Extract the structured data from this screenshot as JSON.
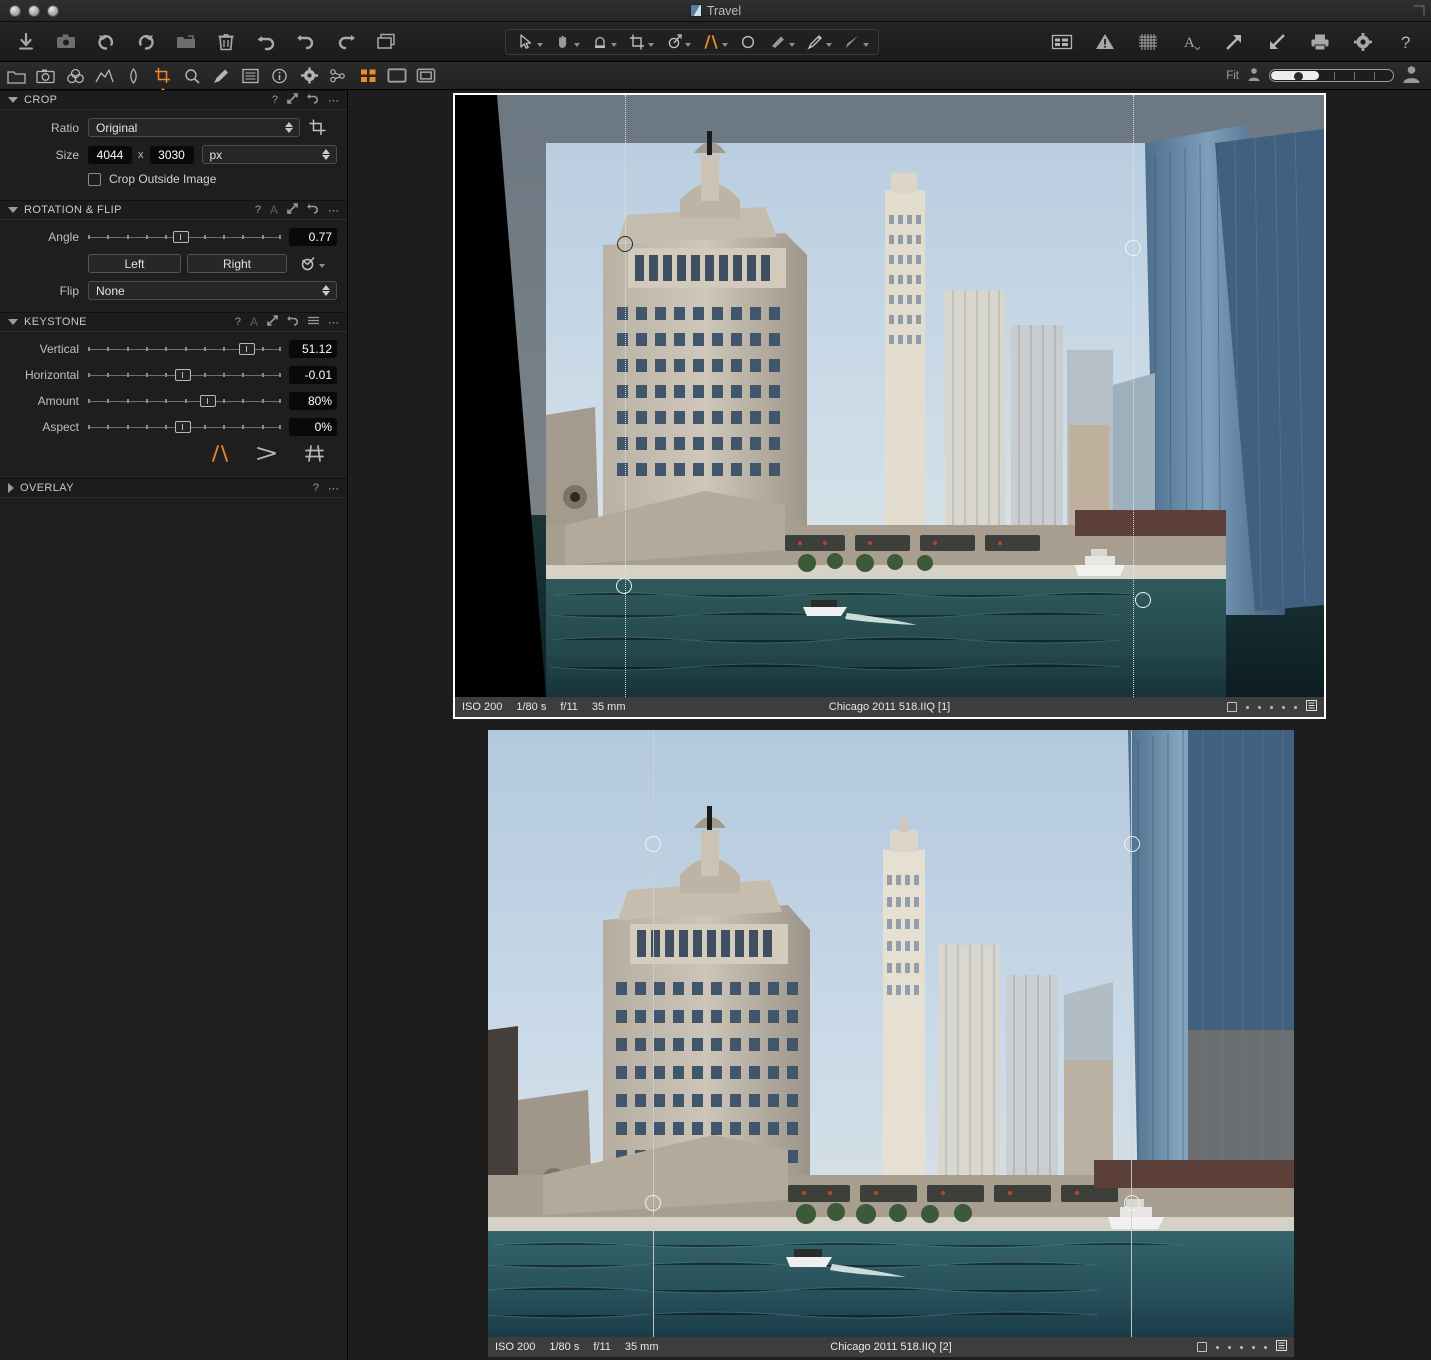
{
  "window": {
    "title": "Travel"
  },
  "toolbar": {
    "left_tools": [
      {
        "name": "import-images-icon",
        "label": "Import Images"
      },
      {
        "name": "capture-icon",
        "label": "Capture"
      },
      {
        "name": "rotate-left-icon",
        "label": "Rotate Left"
      },
      {
        "name": "rotate-right-icon",
        "label": "Rotate Right"
      },
      {
        "name": "move-to-folder-icon",
        "label": "Move to Folder"
      },
      {
        "name": "delete-icon",
        "label": "Delete"
      },
      {
        "name": "reset-icon",
        "label": "Reset Adjustments"
      },
      {
        "name": "undo-icon",
        "label": "Undo"
      },
      {
        "name": "redo-icon",
        "label": "Redo"
      },
      {
        "name": "copy-apply-icon",
        "label": "Copy and Apply Adjustments"
      }
    ],
    "center_tools": [
      {
        "name": "pointer-tool-icon",
        "label": "Select"
      },
      {
        "name": "pan-tool-icon",
        "label": "Pan"
      },
      {
        "name": "color-picker-tool-icon",
        "label": "Pick Color"
      },
      {
        "name": "crop-tool-icon",
        "label": "Crop"
      },
      {
        "name": "rotate-tool-icon",
        "label": "Straighten"
      },
      {
        "name": "keystone-tool-icon",
        "label": "Keystone",
        "active": true
      },
      {
        "name": "mask-circle-tool-icon",
        "label": "Draw Mask"
      },
      {
        "name": "eraser-tool-icon",
        "label": "Erase Mask"
      },
      {
        "name": "heal-brush-tool-icon",
        "label": "Heal Brush"
      },
      {
        "name": "clone-brush-tool-icon",
        "label": "Clone Brush"
      }
    ],
    "right_tools": [
      {
        "name": "viewer-layout-icon",
        "label": "Customize Viewer"
      },
      {
        "name": "exposure-warning-icon",
        "label": "Exposure Warning"
      },
      {
        "name": "grid-overlay-icon",
        "label": "Grid"
      },
      {
        "name": "font-size-icon",
        "label": "Proof Profile"
      },
      {
        "name": "export-arrow-icon",
        "label": "Process"
      },
      {
        "name": "import-arrow-icon",
        "label": "Import"
      },
      {
        "name": "print-icon",
        "label": "Print"
      },
      {
        "name": "preferences-gear-icon",
        "label": "Preferences"
      },
      {
        "name": "help-icon",
        "label": "Help"
      }
    ]
  },
  "tool_tabs": [
    {
      "name": "library-tab",
      "icon": "folder-icon",
      "label": "Library"
    },
    {
      "name": "capture-tab",
      "icon": "camera-icon",
      "label": "Capture"
    },
    {
      "name": "color-tab",
      "icon": "color-circles-icon",
      "label": "Color"
    },
    {
      "name": "exposure-tab",
      "icon": "histogram-icon",
      "label": "Exposure"
    },
    {
      "name": "details-tab",
      "icon": "lens-drop-icon",
      "label": "Details"
    },
    {
      "name": "composition-tab",
      "icon": "crop-icon",
      "label": "Composition",
      "active": true
    },
    {
      "name": "local-adjust-tab",
      "icon": "magnifier-icon",
      "label": "Local Adjustments"
    },
    {
      "name": "styles-tab",
      "icon": "brush-icon",
      "label": "Adjustments"
    },
    {
      "name": "metadata-tab",
      "icon": "list-icon",
      "label": "Metadata"
    },
    {
      "name": "info-tab",
      "icon": "info-icon",
      "label": "Info"
    },
    {
      "name": "settings-tab",
      "icon": "gear-icon",
      "label": "Settings"
    },
    {
      "name": "batch-tab",
      "icon": "nodes-icon",
      "label": "Batch"
    }
  ],
  "viewer_bar": {
    "view_modes": [
      {
        "name": "browser-grid-mode",
        "label": "Multi View",
        "active": true
      },
      {
        "name": "single-view-mode",
        "label": "Single View"
      },
      {
        "name": "proof-view-mode",
        "label": "Proof View"
      }
    ],
    "zoom_label": "Fit",
    "zoom_percent": 38
  },
  "panels": {
    "crop": {
      "title": "CROP",
      "expanded": true,
      "header_icons": [
        "help-icon",
        "reset-expand-icon",
        "undo-icon",
        "menu-dots-icon"
      ],
      "crop_tool_icon": "crop-icon",
      "ratio": {
        "label": "Ratio",
        "value": "Original"
      },
      "size": {
        "label": "Size",
        "width": "4044",
        "separator": "x",
        "height": "3030",
        "unit": "px"
      },
      "crop_outside": {
        "label": "Crop Outside Image",
        "checked": false
      }
    },
    "rotation_flip": {
      "title": "ROTATION & FLIP",
      "expanded": true,
      "header_icons": [
        "help-icon",
        "auto-A-icon",
        "reset-expand-icon",
        "undo-icon",
        "menu-dots-icon"
      ],
      "angle": {
        "label": "Angle",
        "value": "0.77",
        "knob_percent": 48
      },
      "left_button": "Left",
      "right_button": "Right",
      "rotate_icon": "rotate-straighten-icon",
      "flip": {
        "label": "Flip",
        "value": "None"
      }
    },
    "keystone": {
      "title": "KEYSTONE",
      "expanded": true,
      "header_icons": [
        "help-icon",
        "auto-A-icon",
        "reset-expand-icon",
        "undo-icon",
        "list-icon",
        "menu-dots-icon"
      ],
      "sliders": [
        {
          "name": "vertical",
          "label": "Vertical",
          "value": "51.12",
          "knob_percent": 81
        },
        {
          "name": "horizontal",
          "label": "Horizontal",
          "value": "-0.01",
          "knob_percent": 49
        },
        {
          "name": "amount",
          "label": "Amount",
          "value": "80%",
          "knob_percent": 62
        },
        {
          "name": "aspect",
          "label": "Aspect",
          "value": "0%",
          "knob_percent": 49
        }
      ],
      "mode_icons": [
        {
          "name": "keystone-vertical-icon",
          "label": "Vertical Keystone",
          "active": true
        },
        {
          "name": "keystone-horizontal-icon",
          "label": "Horizontal Keystone",
          "active": false
        },
        {
          "name": "keystone-full-icon",
          "label": "Full Keystone",
          "active": false
        }
      ]
    },
    "overlay": {
      "title": "OVERLAY",
      "expanded": false,
      "header_icons": [
        "help-icon",
        "menu-dots-icon"
      ]
    }
  },
  "viewer": {
    "images": [
      {
        "name": "Chicago 2011 518.IIQ [1]",
        "iso": "ISO 200",
        "shutter": "1/80 s",
        "aperture": "f/11",
        "focal": "35 mm",
        "selected": true,
        "keystone_preview": true,
        "rating_dots": 5,
        "color_tag_icon": "color-tag-icon",
        "meta_icon": "metadata-icon"
      },
      {
        "name": "Chicago 2011 518.IIQ [2]",
        "iso": "ISO 200",
        "shutter": "1/80 s",
        "aperture": "f/11",
        "focal": "35 mm",
        "selected": false,
        "keystone_preview": false,
        "rating_dots": 5,
        "color_tag_icon": "color-tag-icon",
        "meta_icon": "metadata-icon"
      }
    ]
  },
  "colors": {
    "accent": "#ef8b22",
    "panel_bg": "#1e1e1e",
    "viewer_bg": "#1d1d1d",
    "infobar_bg": "#3d3d3d",
    "field_bg": "#090909"
  }
}
